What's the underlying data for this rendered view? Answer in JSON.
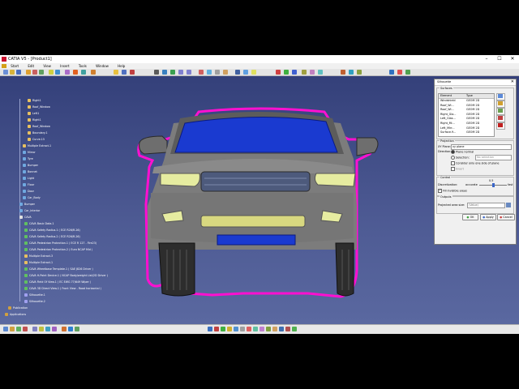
{
  "window": {
    "title": "CATIA V5 - [Product1]",
    "controls": [
      "–",
      "☐",
      "✕"
    ]
  },
  "menu": [
    "Start",
    "Edit",
    "View",
    "Insert",
    "Tools",
    "Window",
    "Help"
  ],
  "tree": {
    "nodes": [
      {
        "label": "Right1",
        "icon": "surface"
      },
      {
        "label": "Roof_Window",
        "icon": "surface"
      },
      {
        "label": "Left1",
        "icon": "surface"
      },
      {
        "label": "Right1",
        "icon": "surface"
      },
      {
        "label": "Roof_Window",
        "icon": "surface"
      },
      {
        "label": "Boundary.1",
        "icon": "surface"
      },
      {
        "label": "Curve.15",
        "icon": "surface"
      },
      {
        "label": "Multiple Extract.1",
        "icon": "surface"
      },
      {
        "label": "Mirror",
        "icon": "geoset"
      },
      {
        "label": "Tyre",
        "icon": "geoset"
      },
      {
        "label": "Bumper",
        "icon": "geoset"
      },
      {
        "label": "Bonnet",
        "icon": "geoset"
      },
      {
        "label": "Light",
        "icon": "geoset"
      },
      {
        "label": "Floor",
        "icon": "geoset"
      },
      {
        "label": "Door",
        "icon": "geoset"
      },
      {
        "label": "Car_Body",
        "icon": "geoset"
      },
      {
        "label": "Bumper",
        "icon": "geoset"
      },
      {
        "label": "Car_Interior",
        "icon": "geoset"
      },
      {
        "label": "CAVA",
        "icon": "cava"
      },
      {
        "label": "CAVA Basic Data.1",
        "icon": "analysis"
      },
      {
        "label": "CAVA Safety Radius.1 ( ECE R26/R-26)",
        "icon": "analysis"
      },
      {
        "label": "CAVA Safety Radius.2 ( ECE R26/R-26)",
        "icon": "analysis"
      },
      {
        "label": "CAVA Pedestrian Protection.1 ( ECE R 127 - Fire23)",
        "icon": "analysis"
      },
      {
        "label": "CAVA Pedestrian Protection.2 ( Euro NCAP Mid )",
        "icon": "analysis"
      },
      {
        "label": "Multiple Extract.3",
        "icon": "surface"
      },
      {
        "label": "Multiple Extract.1",
        "icon": "surface"
      },
      {
        "label": "CAVA Wheelbase Template.1 ( SAE J826 Driver )",
        "icon": "analysis"
      },
      {
        "label": "CAVA H-Point Device.1 ( NCAP Body/weight List/2D Driver )",
        "icon": "analysis"
      },
      {
        "label": "CAVA Field Of View.1 ( EC EWG 77/649 Wiper )",
        "icon": "analysis"
      },
      {
        "label": "CAVA 3D Direct View.1 ( Front View - Road horizontal )",
        "icon": "analysis"
      },
      {
        "label": "Silhouette.1",
        "icon": "silhouette"
      },
      {
        "label": "Silhouette.2",
        "icon": "silhouette"
      },
      {
        "label": "Publication",
        "icon": "root"
      },
      {
        "label": "Applications",
        "icon": "root"
      }
    ]
  },
  "dialog": {
    "title": "Silhouette",
    "close": "✕",
    "surfaces_label": "Surfaces",
    "table_headers": [
      "Element",
      "Type"
    ],
    "table_rows": [
      [
        "Windshield",
        "GEOM 2D"
      ],
      [
        "Roof_Wi...",
        "GEOM 2D"
      ],
      [
        "Roof_Wi...",
        "GEOM 2D"
      ],
      [
        "Right_Gla...",
        "GEOM 2D"
      ],
      [
        "Left_Glas...",
        "GEOM 2D"
      ],
      [
        "Right_Mi...",
        "GEOM 2D"
      ],
      [
        "Left_Mirr...",
        "GEOM 2D"
      ],
      [
        "Surface.9...",
        "GEOM 2D"
      ]
    ],
    "projection_label": "Projection",
    "xy_plane_label": "XY Plane:",
    "xy_plane_value": "xy plane",
    "direction_label": "Direction:",
    "plane_normal": "Plane normal",
    "selection": "Selection:",
    "selection_value": "No selection",
    "consider_one_side": "Consider only one side of plane",
    "invert": "Invert",
    "control_label": "Control",
    "discretization_label": "Discretization:",
    "accurate": "accurate",
    "fast": "fast",
    "slider_value": "0.5",
    "slider_position": 0.5,
    "fill_invisible": "Fill invisible areas",
    "outputs_label": "Outputs",
    "projected_area_label": "Projected area size:",
    "projected_area_value": "(Value)",
    "ok": "OK",
    "apply": "Apply",
    "cancel": "Cancel"
  },
  "colors": {
    "viewport_top": "#34407a",
    "viewport_bottom": "#5a68a0",
    "silhouette": "#ff10d0",
    "windshield": "#1030c0",
    "car_body": "#7a7a7a",
    "headlight": "#e6eca0"
  }
}
